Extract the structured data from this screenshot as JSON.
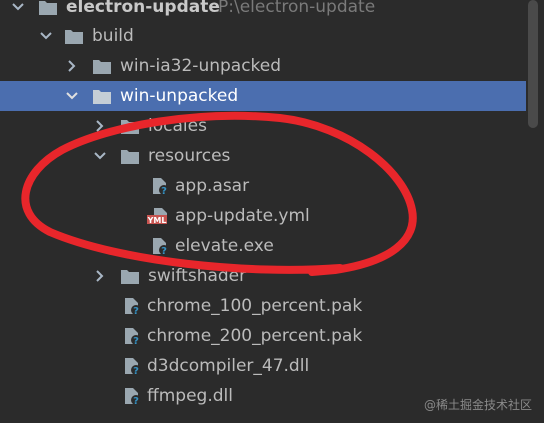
{
  "project": {
    "name": "electron-update",
    "path": "P:\\electron-update"
  },
  "tree": [
    {
      "label": "build",
      "icon": "folder-icon",
      "expanded": true
    },
    {
      "label": "win-ia32-unpacked",
      "icon": "folder-icon",
      "expanded": false
    },
    {
      "label": "win-unpacked",
      "icon": "folder-icon",
      "expanded": true,
      "selected": true
    },
    {
      "label": "locales",
      "icon": "folder-icon",
      "expanded": false
    },
    {
      "label": "resources",
      "icon": "folder-icon",
      "expanded": true
    },
    {
      "label": "app.asar",
      "icon": "unknown-file-icon"
    },
    {
      "label": "app-update.yml",
      "icon": "yml-file-icon",
      "badge": "YML"
    },
    {
      "label": "elevate.exe",
      "icon": "unknown-file-icon"
    },
    {
      "label": "swiftshader",
      "icon": "folder-icon",
      "expanded": false
    },
    {
      "label": "chrome_100_percent.pak",
      "icon": "unknown-file-icon"
    },
    {
      "label": "chrome_200_percent.pak",
      "icon": "unknown-file-icon"
    },
    {
      "label": "d3dcompiler_47.dll",
      "icon": "unknown-file-icon"
    },
    {
      "label": "ffmpeg.dll",
      "icon": "unknown-file-icon"
    }
  ],
  "watermark": "@稀土掘金技术社区",
  "colors": {
    "background": "#2b2b2b",
    "selection": "#4b6eaf",
    "text": "#bbbbbb",
    "folder": "#9aa7b0",
    "annotation": "#e8262b",
    "yml_badge": "#c75450"
  }
}
